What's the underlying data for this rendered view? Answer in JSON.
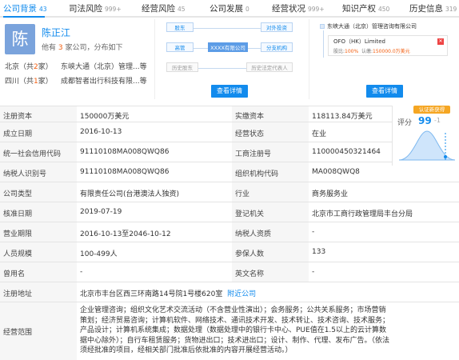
{
  "tabs": [
    {
      "label": "公司背景",
      "count": "43",
      "active": true
    },
    {
      "label": "司法风险",
      "count": "999+"
    },
    {
      "label": "经营风险",
      "count": "45"
    },
    {
      "label": "公司发展",
      "count": "0"
    },
    {
      "label": "经营状况",
      "count": "999+"
    },
    {
      "label": "知识产权",
      "count": "450"
    },
    {
      "label": "历史信息",
      "count": "319"
    }
  ],
  "person": {
    "avatar_char": "陈",
    "name": "陈正江",
    "desc_prefix": "他有",
    "desc_num": "3",
    "desc_suffix": "家公司，分布如下",
    "rows": [
      {
        "region": "北京",
        "count_prefix": "（共",
        "count": "2",
        "count_suffix": "家）",
        "company": "东峡大通（北京）管理...等"
      },
      {
        "region": "四川",
        "count_prefix": "（共",
        "count": "1",
        "count_suffix": "家）",
        "company": "成都智者出行科技有限...等"
      }
    ]
  },
  "diagram": {
    "boxes": {
      "shareholder": "股东",
      "investment": "对外投资",
      "executive": "高管",
      "center": "XXXX有限公司",
      "branch": "分支机构",
      "hist_shareholder": "历史股东",
      "hist_legal": "历史法定代表人"
    },
    "button": "查看详情"
  },
  "investment": {
    "parent": "东峡大通（北京）管理咨询有限公司",
    "company": "OFO（HK）Limited",
    "ratio_label": "股比:",
    "ratio": "100%",
    "amount_label": "认缴:",
    "amount": "150000.0万美元",
    "button": "查看详情"
  },
  "info": {
    "registered_capital_label": "注册资本",
    "registered_capital": "150000万美元",
    "paid_capital_label": "实缴资本",
    "paid_capital": "118113.84万美元",
    "established_label": "成立日期",
    "established": "2016-10-13",
    "status_label": "经营状态",
    "status": "在业",
    "credit_code_label": "统一社会信用代码",
    "credit_code": "91110108MA008QWQ86",
    "reg_no_label": "工商注册号",
    "reg_no": "110000450321464",
    "taxpayer_label": "纳税人识别号",
    "taxpayer": "91110108MA008QWQ86",
    "org_code_label": "组织机构代码",
    "org_code": "MA008QWQ8",
    "type_label": "公司类型",
    "type": "有限责任公司(台港澳法人独资)",
    "industry_label": "行业",
    "industry": "商务服务业",
    "approval_label": "核准日期",
    "approval": "2019-07-19",
    "authority_label": "登记机关",
    "authority": "北京市工商行政管理局丰台分局",
    "term_label": "营业期限",
    "term": "2016-10-13至2046-10-12",
    "taxpayer_qual_label": "纳税人资质",
    "taxpayer_qual": "-",
    "staff_label": "人员规模",
    "staff": "100-499人",
    "insured_label": "参保人数",
    "insured": "133",
    "former_name_label": "曾用名",
    "former_name": "-",
    "english_name_label": "英文名称",
    "english_name": "-",
    "address_label": "注册地址",
    "address": "北京市丰台区西三环南路14号院1号楼620室",
    "nearby": "附近公司",
    "scope_label": "经营范围",
    "scope": "企业管理咨询；组织文化艺术交流活动（不含营业性演出）；会务服务；公共关系服务；市场营销策划；经济贸易咨询；计算机软件、网络技术、通讯技术开发、技术转让、技术咨询、技术服务；产品设计；计算机系统集成；数据处理（数据处理中的银行卡中心、PUE值在1.5以上的云计算数据中心除外）；自行车租赁服务；货物进出口；技术进出口；设计、制作、代理、发布广告。（依法须经批准的项目，经相关部门批准后依批准的内容开展经营活动。）"
  },
  "score": {
    "badge": "认证新获得",
    "label": "评分",
    "value": "99",
    "delta": "-1"
  },
  "colors": {
    "accent": "#128bed",
    "highlight": "#f25d0e",
    "badge": "#f5a623"
  }
}
